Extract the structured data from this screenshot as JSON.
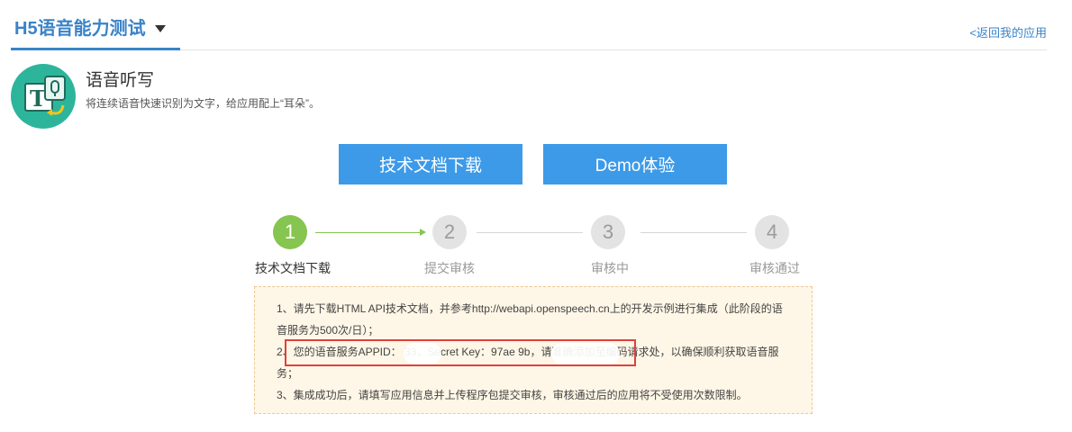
{
  "header": {
    "title": "H5语音能力测试",
    "back_link": "<返回我的应用"
  },
  "app": {
    "icon": "speech-to-text-icon",
    "name": "语音听写",
    "description": "将连续语音快速识别为文字，给应用配上“耳朵”。"
  },
  "buttons": {
    "doc_download": "技术文档下载",
    "demo": "Demo体验"
  },
  "steps": [
    {
      "number": "1",
      "label": "技术文档下载",
      "active": true
    },
    {
      "number": "2",
      "label": "提交审核",
      "active": false
    },
    {
      "number": "3",
      "label": "审核中",
      "active": false
    },
    {
      "number": "4",
      "label": "审核通过",
      "active": false
    }
  ],
  "notice": {
    "line1": "1、请先下载HTML API技术文档，并参考http://webapi.openspeech.cn上的开发示例进行集成（此阶段的语音服务为500次/日）；",
    "line2": "2、您的语音服务APPID：        33，Secret Key：97ae                9b，请准确添加至编码请求处，以确保顺利获取语音服务；",
    "line3": "3、集成成功后，请填写应用信息并上传程序包提交审核，审核通过后的应用将不受使用次数限制。"
  },
  "colors": {
    "brand_blue": "#3a83c8",
    "button_blue": "#3d9ae8",
    "step_active": "#86c54f",
    "highlight_red": "#e0403f"
  }
}
